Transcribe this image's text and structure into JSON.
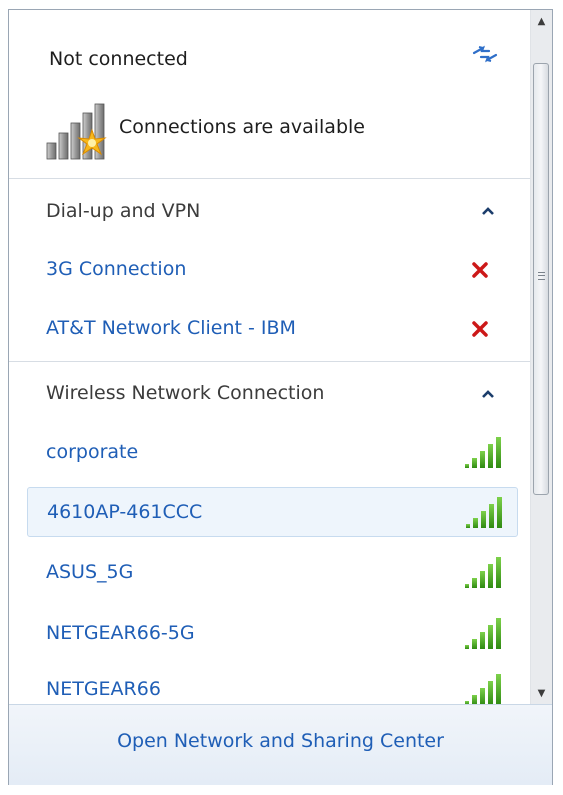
{
  "status": {
    "title": "Not connected",
    "subtitle": "Connections are available"
  },
  "sections": [
    {
      "header": "Dial-up and VPN",
      "items": [
        {
          "label": "3G Connection",
          "action_icon": "disconnect-x-icon"
        },
        {
          "label": "AT&T Network Client - IBM",
          "action_icon": "disconnect-x-icon"
        }
      ]
    },
    {
      "header": "Wireless Network Connection",
      "items": [
        {
          "label": "corporate",
          "signal_strength": 1.0
        },
        {
          "label": "4610AP-461CCC",
          "signal_strength": 1.0,
          "selected": true
        },
        {
          "label": "ASUS_5G",
          "signal_strength": 1.0
        },
        {
          "label": "NETGEAR66-5G",
          "signal_strength": 1.0
        },
        {
          "label": "NETGEAR66",
          "signal_strength": 1.0
        }
      ]
    }
  ],
  "footer": {
    "link": "Open Network and Sharing Center"
  },
  "colors": {
    "link_blue": "#1f5eb6",
    "signal_green": "#3e9b1f",
    "disconnect_red": "#cc1818",
    "selection_bg": "#eef5fc"
  }
}
